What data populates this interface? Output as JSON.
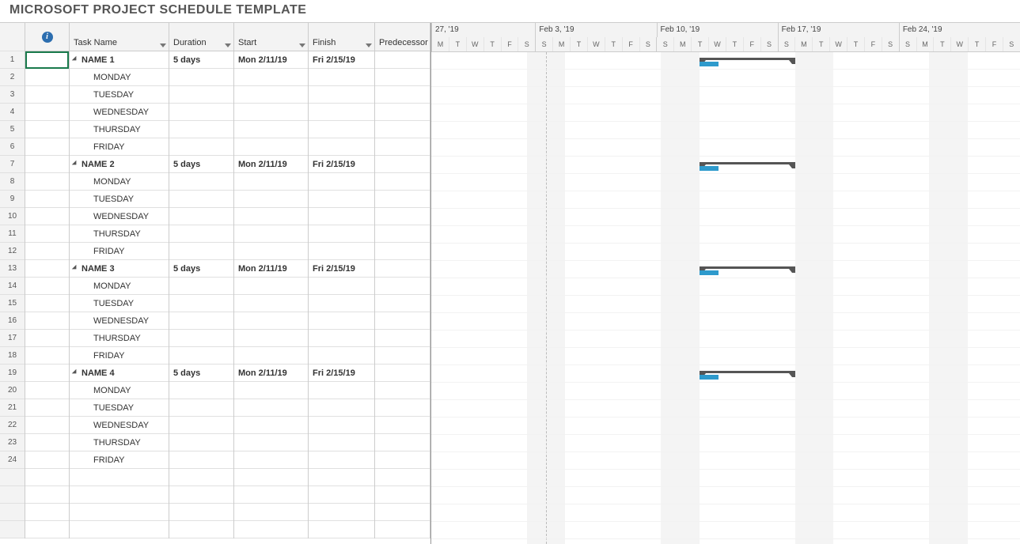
{
  "title": "MICROSOFT PROJECT SCHEDULE TEMPLATE",
  "columns": {
    "task": "Task Name",
    "duration": "Duration",
    "start": "Start",
    "finish": "Finish",
    "pred": "Predecessor"
  },
  "rows": [
    {
      "num": "1",
      "type": "summary",
      "task": "NAME 1",
      "duration": "5 days",
      "start": "Mon 2/11/19",
      "finish": "Fri 2/15/19",
      "selected": true
    },
    {
      "num": "2",
      "type": "child",
      "task": "MONDAY"
    },
    {
      "num": "3",
      "type": "child",
      "task": "TUESDAY"
    },
    {
      "num": "4",
      "type": "child",
      "task": "WEDNESDAY"
    },
    {
      "num": "5",
      "type": "child",
      "task": "THURSDAY"
    },
    {
      "num": "6",
      "type": "child",
      "task": "FRIDAY"
    },
    {
      "num": "7",
      "type": "summary",
      "task": "NAME 2",
      "duration": "5 days",
      "start": "Mon 2/11/19",
      "finish": "Fri 2/15/19"
    },
    {
      "num": "8",
      "type": "child",
      "task": "MONDAY"
    },
    {
      "num": "9",
      "type": "child",
      "task": "TUESDAY"
    },
    {
      "num": "10",
      "type": "child",
      "task": "WEDNESDAY"
    },
    {
      "num": "11",
      "type": "child",
      "task": "THURSDAY"
    },
    {
      "num": "12",
      "type": "child",
      "task": "FRIDAY"
    },
    {
      "num": "13",
      "type": "summary",
      "task": "NAME 3",
      "duration": "5 days",
      "start": "Mon 2/11/19",
      "finish": "Fri 2/15/19"
    },
    {
      "num": "14",
      "type": "child",
      "task": "MONDAY"
    },
    {
      "num": "15",
      "type": "child",
      "task": "TUESDAY"
    },
    {
      "num": "16",
      "type": "child",
      "task": "WEDNESDAY"
    },
    {
      "num": "17",
      "type": "child",
      "task": "THURSDAY"
    },
    {
      "num": "18",
      "type": "child",
      "task": "FRIDAY"
    },
    {
      "num": "19",
      "type": "summary",
      "task": "NAME 4",
      "duration": "5 days",
      "start": "Mon 2/11/19",
      "finish": "Fri 2/15/19"
    },
    {
      "num": "20",
      "type": "child",
      "task": "MONDAY"
    },
    {
      "num": "21",
      "type": "child",
      "task": "TUESDAY"
    },
    {
      "num": "22",
      "type": "child",
      "task": "WEDNESDAY"
    },
    {
      "num": "23",
      "type": "child",
      "task": "THURSDAY"
    },
    {
      "num": "24",
      "type": "child",
      "task": "FRIDAY"
    },
    {
      "num": "",
      "type": "blank"
    },
    {
      "num": "",
      "type": "blank"
    },
    {
      "num": "",
      "type": "blank"
    },
    {
      "num": "",
      "type": "blank"
    }
  ],
  "timeline": {
    "weeks": [
      "27, '19",
      "Feb 3, '19",
      "Feb 10, '19",
      "Feb 17, '19",
      "Feb 24, '19"
    ],
    "first_week_days": 6,
    "day_letters": [
      "S",
      "M",
      "T",
      "W",
      "T",
      "F",
      "S"
    ],
    "day_width": 24.2,
    "weekend_positions_s1": [
      5
    ],
    "weekend_positions": [
      6,
      13,
      20,
      27
    ],
    "bar_start_day": 16,
    "bar_days": 5,
    "progress_days": 1
  },
  "chart_data": {
    "type": "gantt",
    "tasks": [
      {
        "name": "NAME 1",
        "start": "2019-02-11",
        "finish": "2019-02-15",
        "duration_days": 5,
        "progress_days": 1,
        "row": 1
      },
      {
        "name": "NAME 2",
        "start": "2019-02-11",
        "finish": "2019-02-15",
        "duration_days": 5,
        "progress_days": 1,
        "row": 7
      },
      {
        "name": "NAME 3",
        "start": "2019-02-11",
        "finish": "2019-02-15",
        "duration_days": 5,
        "progress_days": 1,
        "row": 13
      },
      {
        "name": "NAME 4",
        "start": "2019-02-11",
        "finish": "2019-02-15",
        "duration_days": 5,
        "progress_days": 1,
        "row": 19
      }
    ],
    "timeline_start": "2019-01-27",
    "week_starts": [
      "2019-01-27",
      "2019-02-03",
      "2019-02-10",
      "2019-02-17",
      "2019-02-24"
    ]
  }
}
